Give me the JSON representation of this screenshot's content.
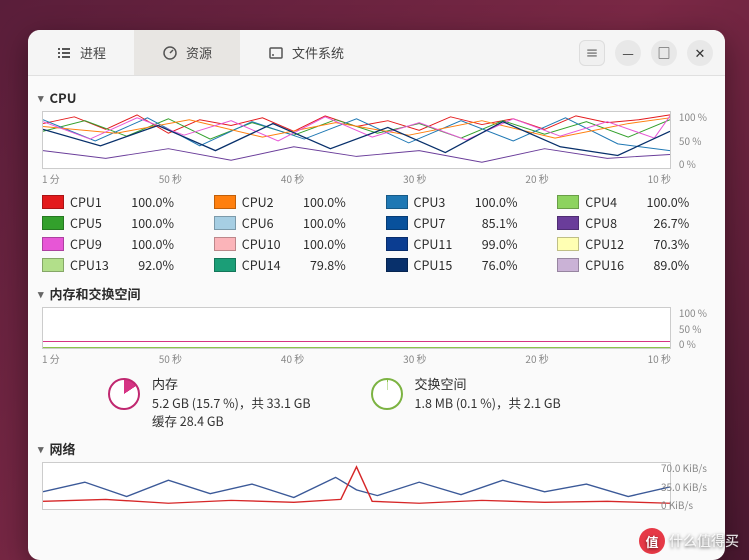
{
  "tabs": {
    "processes": "进程",
    "resources": "资源",
    "filesystems": "文件系统"
  },
  "sections": {
    "cpu": "CPU",
    "memory": "内存和交换空间",
    "network": "网络"
  },
  "axis": {
    "y100": "100 %",
    "y50": "50 %",
    "y0": "0 %",
    "net_top": "70.0 KiB/s",
    "net_mid": "35.0 KiB/s",
    "net_bot": "0 KiB/s"
  },
  "xaxis": [
    "1 分",
    "50 秒",
    "40 秒",
    "30 秒",
    "20 秒",
    "10 秒"
  ],
  "cpus": [
    {
      "name": "CPU1",
      "pct": "100.0%",
      "color": "#e31a1c"
    },
    {
      "name": "CPU2",
      "pct": "100.0%",
      "color": "#ff7f0e"
    },
    {
      "name": "CPU3",
      "pct": "100.0%",
      "color": "#1f78b4"
    },
    {
      "name": "CPU4",
      "pct": "100.0%",
      "color": "#8dd35f"
    },
    {
      "name": "CPU5",
      "pct": "100.0%",
      "color": "#33a02c"
    },
    {
      "name": "CPU6",
      "pct": "100.0%",
      "color": "#a6cee3"
    },
    {
      "name": "CPU7",
      "pct": "85.1%",
      "color": "#08519c"
    },
    {
      "name": "CPU8",
      "pct": "26.7%",
      "color": "#6a3d9a"
    },
    {
      "name": "CPU9",
      "pct": "100.0%",
      "color": "#e756d6"
    },
    {
      "name": "CPU10",
      "pct": "100.0%",
      "color": "#fbb4b9"
    },
    {
      "name": "CPU11",
      "pct": "99.0%",
      "color": "#0b3d91"
    },
    {
      "name": "CPU12",
      "pct": "70.3%",
      "color": "#ffffb3"
    },
    {
      "name": "CPU13",
      "pct": "92.0%",
      "color": "#b2df8a"
    },
    {
      "name": "CPU14",
      "pct": "79.8%",
      "color": "#1b9e77"
    },
    {
      "name": "CPU15",
      "pct": "76.0%",
      "color": "#08306b"
    },
    {
      "name": "CPU16",
      "pct": "89.0%",
      "color": "#cab2d6"
    }
  ],
  "memory": {
    "title": "内存",
    "line1": "5.2 GB (15.7 %)，共 33.1 GB",
    "line2": "缓存 28.4 GB"
  },
  "swap": {
    "title": "交换空间",
    "line1": "1.8 MB (0.1 %)，共 2.1 GB"
  },
  "watermark": "什么值得买",
  "chart_data": [
    {
      "type": "line",
      "title": "CPU",
      "xlabel": "seconds ago",
      "ylabel": "%",
      "ylim": [
        0,
        100
      ],
      "x_ticks": [
        60,
        50,
        40,
        30,
        20,
        10
      ],
      "series_note": "16 CPU cores fluctuating mostly 70–100%, unreadable per-point values",
      "current_values": {
        "CPU1": 100.0,
        "CPU2": 100.0,
        "CPU3": 100.0,
        "CPU4": 100.0,
        "CPU5": 100.0,
        "CPU6": 100.0,
        "CPU7": 85.1,
        "CPU8": 26.7,
        "CPU9": 100.0,
        "CPU10": 100.0,
        "CPU11": 99.0,
        "CPU12": 70.3,
        "CPU13": 92.0,
        "CPU14": 79.8,
        "CPU15": 76.0,
        "CPU16": 89.0
      }
    },
    {
      "type": "line",
      "title": "内存和交换空间",
      "ylim": [
        0,
        100
      ],
      "series": [
        {
          "name": "内存",
          "approx_value_pct": 15.7,
          "color": "#d63384"
        },
        {
          "name": "交换空间",
          "approx_value_pct": 0.1,
          "color": "#8bc34a"
        }
      ]
    },
    {
      "type": "line",
      "title": "网络",
      "ylabel": "KiB/s",
      "ylim": [
        0,
        70
      ],
      "series_note": "two series (rx/tx) oscillating roughly 5–40 KiB/s with single red spike to ~70 near 30s"
    }
  ]
}
